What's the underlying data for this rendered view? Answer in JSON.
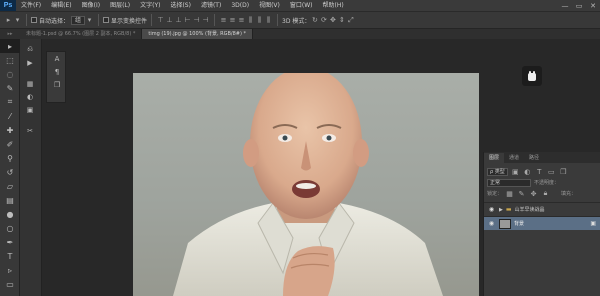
{
  "app": {
    "logo": "Ps"
  },
  "menu": [
    "文件(F)",
    "编辑(E)",
    "图像(I)",
    "图层(L)",
    "文字(Y)",
    "选择(S)",
    "滤镜(T)",
    "3D(D)",
    "视图(V)",
    "窗口(W)",
    "帮助(H)"
  ],
  "window_controls": {
    "minimize": "—",
    "restore": "▭",
    "close": "✕"
  },
  "options": {
    "auto_select_label": "自动选择：",
    "auto_select_value": "组",
    "show_transform_label": "显示变换控件",
    "mode_3d_label": "3D 模式："
  },
  "tabs": [
    {
      "label": "未标题-1.psd @ 66.7% (图层 2 副本, RGB/8) *",
      "active": false
    },
    {
      "label": "timg (19).jpg @ 100% (背景, RGB/8#) *",
      "active": true
    }
  ],
  "toolbox_grip": "▸▸",
  "layers_panel": {
    "tabs": [
      "图层",
      "通道",
      "路径"
    ],
    "kind_label": "ρ 类型",
    "blend_mode": "正常",
    "opacity_label": "不透明度：",
    "lock_label": "锁定：",
    "fill_label": "填充：",
    "layers": [
      {
        "name": "山羊早读战晶",
        "type": "group",
        "selected": false
      },
      {
        "name": "背景",
        "type": "image",
        "selected": true
      }
    ]
  },
  "colors": {
    "accent": "#5fb1ff",
    "selected_layer": "#5b6f86",
    "bg": "#282828"
  }
}
